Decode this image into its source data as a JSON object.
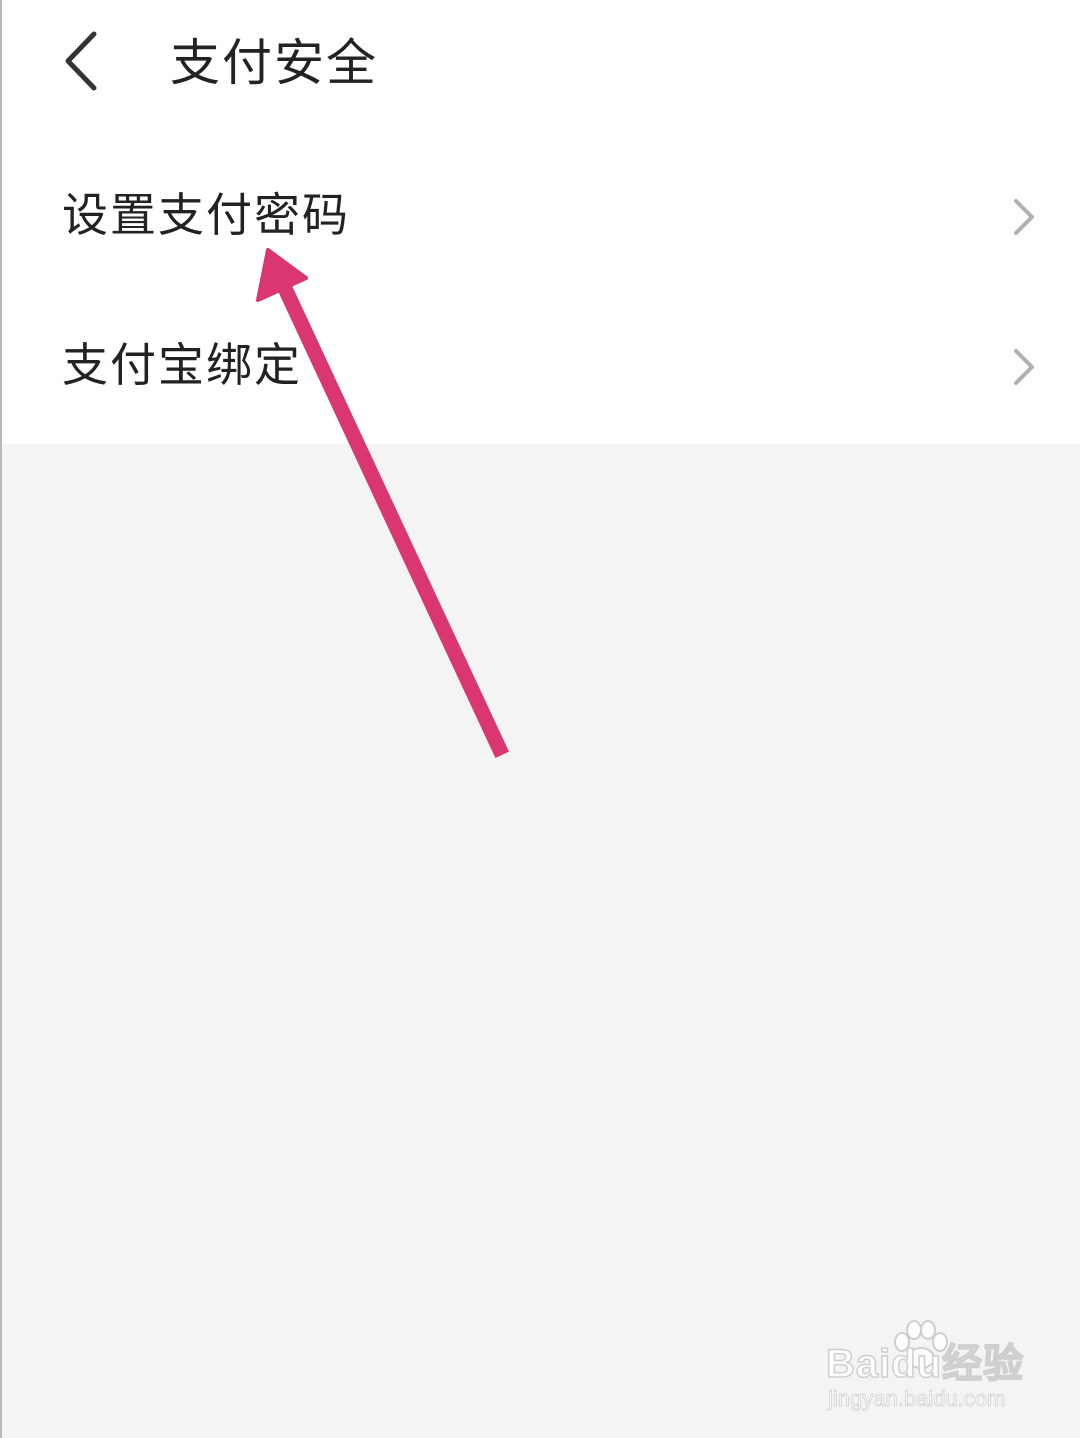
{
  "header": {
    "back_icon": "chevron-left-icon",
    "title": "支付安全"
  },
  "menu": {
    "items": [
      {
        "label": "设置支付密码",
        "icon": "chevron-right-icon"
      },
      {
        "label": "支付宝绑定",
        "icon": "chevron-right-icon"
      }
    ]
  },
  "annotation": {
    "type": "arrow",
    "color": "#d93672",
    "points_to": "设置支付密码"
  },
  "watermark": {
    "brand": "Baidu经验",
    "url": "jingyan.baidu.com"
  },
  "colors": {
    "page_background": "#f4f4f4",
    "surface": "#ffffff",
    "text": "#222222",
    "chevron": "#b0b0b0",
    "arrow": "#d93672"
  }
}
